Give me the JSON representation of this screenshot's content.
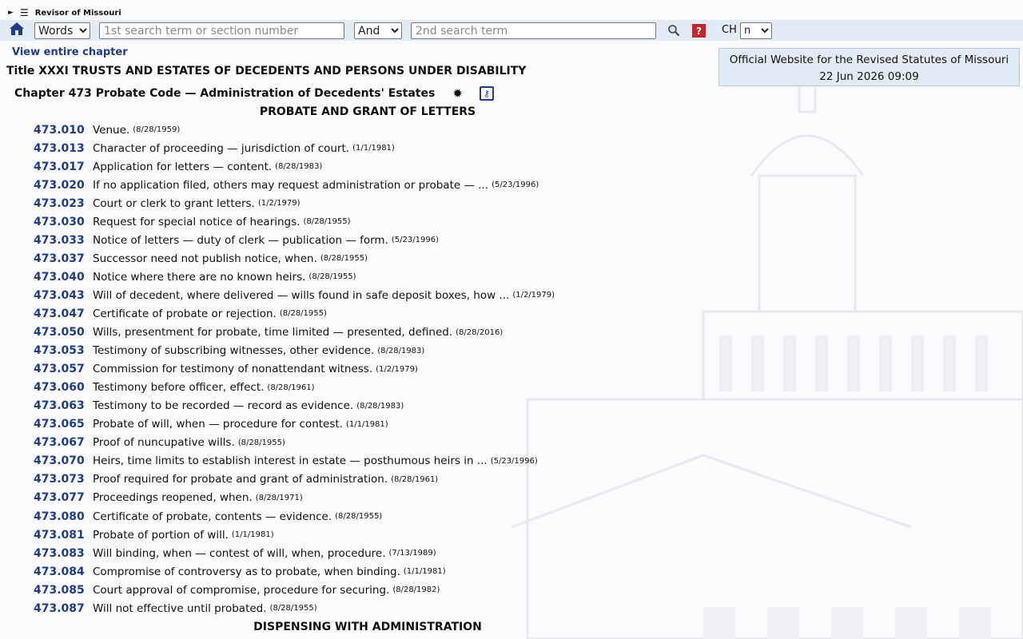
{
  "site": {
    "name": "Revisor of Missouri"
  },
  "search": {
    "mode_value": "Words",
    "mode_options": [
      "Words"
    ],
    "term1_placeholder": "1st search term or section number",
    "term1_value": "",
    "operator_value": "And",
    "operator_options": [
      "And"
    ],
    "term2_placeholder": "2nd search term",
    "term2_value": "",
    "help_glyph": "?",
    "ch_label": "CH",
    "ch_value": "n",
    "ch_options": [
      "n"
    ]
  },
  "nav": {
    "view_chapter": "View entire chapter"
  },
  "official": {
    "text": "Official Website for the Revised Statutes of Missouri",
    "datetime": "22 Jun 2026 09:09"
  },
  "title_line": "Title XXXI TRUSTS AND ESTATES OF DECEDENTS AND PERSONS UNDER DISABILITY",
  "chapter_line": "Chapter 473 Probate Code — Administration of Decedents' Estates",
  "headings": [
    "PROBATE AND GRANT OF LETTERS",
    "DISPENSING WITH ADMINISTRATION"
  ],
  "sections": [
    {
      "num": "473.010",
      "title": "Venue.",
      "date": "(8/28/1959)"
    },
    {
      "num": "473.013",
      "title": "Character of proceeding — jurisdiction of court.",
      "date": "(1/1/1981)"
    },
    {
      "num": "473.017",
      "title": "Application for letters — content.",
      "date": "(8/28/1983)"
    },
    {
      "num": "473.020",
      "title": "If no application filed, others may request administration or probate — ...",
      "date": "(5/23/1996)"
    },
    {
      "num": "473.023",
      "title": "Court or clerk to grant letters.",
      "date": "(1/2/1979)"
    },
    {
      "num": "473.030",
      "title": "Request for special notice of hearings.",
      "date": "(8/28/1955)"
    },
    {
      "num": "473.033",
      "title": "Notice of letters — duty of clerk — publication — form.",
      "date": "(5/23/1996)"
    },
    {
      "num": "473.037",
      "title": "Successor need not publish notice, when.",
      "date": "(8/28/1955)"
    },
    {
      "num": "473.040",
      "title": "Notice where there are no known heirs.",
      "date": "(8/28/1955)"
    },
    {
      "num": "473.043",
      "title": "Will of decedent, where delivered — wills found in safe deposit boxes, how ...",
      "date": "(1/2/1979)"
    },
    {
      "num": "473.047",
      "title": "Certificate of probate or rejection.",
      "date": "(8/28/1955)"
    },
    {
      "num": "473.050",
      "title": "Wills, presentment for probate, time limited — presented, defined.",
      "date": "(8/28/2016)"
    },
    {
      "num": "473.053",
      "title": "Testimony of subscribing witnesses, other evidence.",
      "date": "(8/28/1983)"
    },
    {
      "num": "473.057",
      "title": "Commission for testimony of nonattendant witness.",
      "date": "(1/2/1979)"
    },
    {
      "num": "473.060",
      "title": "Testimony before officer, effect.",
      "date": "(8/28/1961)"
    },
    {
      "num": "473.063",
      "title": "Testimony to be recorded — record as evidence.",
      "date": "(8/28/1983)"
    },
    {
      "num": "473.065",
      "title": "Probate of will, when — procedure for contest.",
      "date": "(1/1/1981)"
    },
    {
      "num": "473.067",
      "title": "Proof of nuncupative wills.",
      "date": "(8/28/1955)"
    },
    {
      "num": "473.070",
      "title": "Heirs, time limits to establish interest in estate — posthumous heirs in ...",
      "date": "(5/23/1996)"
    },
    {
      "num": "473.073",
      "title": "Proof required for probate and grant of administration.",
      "date": "(8/28/1961)"
    },
    {
      "num": "473.077",
      "title": "Proceedings reopened, when.",
      "date": "(8/28/1971)"
    },
    {
      "num": "473.080",
      "title": "Certificate of probate, contents — evidence.",
      "date": "(8/28/1955)"
    },
    {
      "num": "473.081",
      "title": "Probate of portion of will.",
      "date": "(1/1/1981)"
    },
    {
      "num": "473.083",
      "title": "Will binding, when — contest of will, when, procedure.",
      "date": "(7/13/1989)"
    },
    {
      "num": "473.084",
      "title": "Compromise of controversy as to probate, when binding.",
      "date": "(1/1/1981)"
    },
    {
      "num": "473.085",
      "title": "Court approval of compromise, procedure for securing.",
      "date": "(8/28/1982)"
    },
    {
      "num": "473.087",
      "title": "Will not effective until probated.",
      "date": "(8/28/1955)"
    }
  ]
}
